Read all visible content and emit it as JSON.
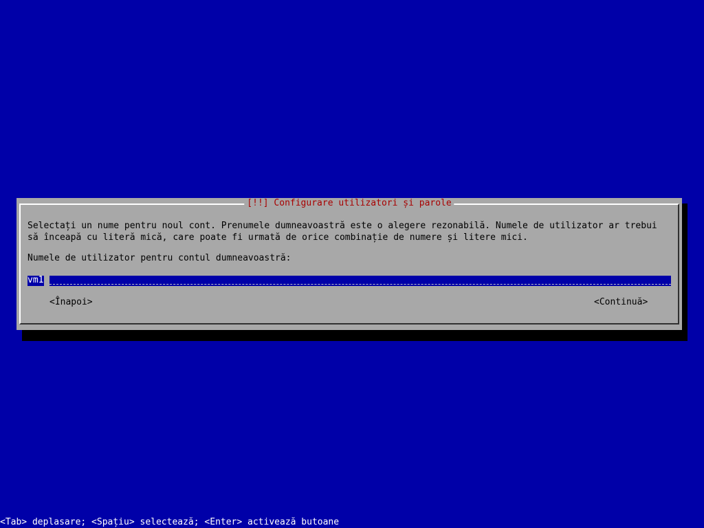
{
  "dialog": {
    "title": "[!!] Configurare utilizatori și parole",
    "message_line1": "Selectați un nume pentru noul cont. Prenumele dumneavoastră este o alegere rezonabilă. Numele de utilizator ar trebui",
    "message_line2": "să înceapă cu literă mică, care poate fi urmată de orice combinație de numere și litere mici.",
    "prompt": "Numele de utilizator pentru contul dumneavoastră:",
    "username_value": "vm1",
    "back_button": "<Înapoi>",
    "continue_button": "<Continuă>"
  },
  "status_bar": {
    "help": "<Tab> deplasare; <Spațiu> selectează; <Enter> activează butoane"
  },
  "colors": {
    "background": "#0000a8",
    "dialog": "#a8a8a8",
    "title": "#a80000",
    "input": "#0000a8"
  }
}
